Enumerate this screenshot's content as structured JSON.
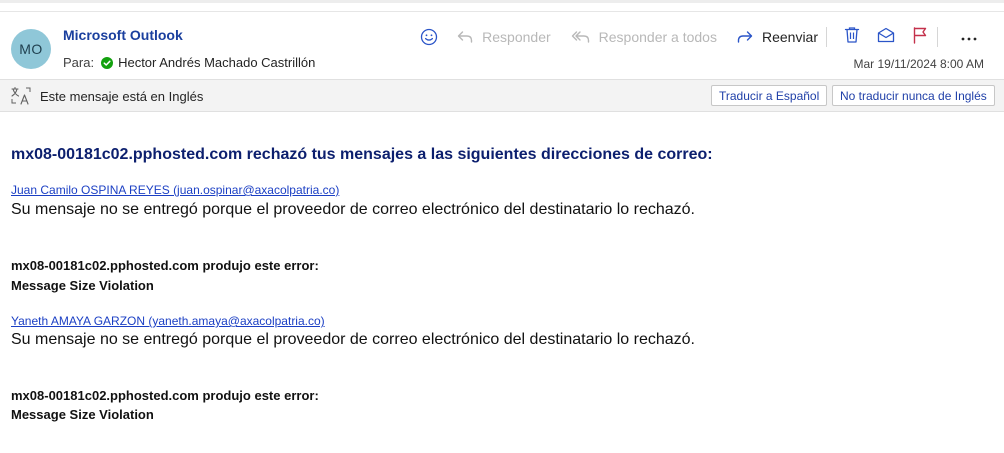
{
  "header": {
    "avatar_initials": "MO",
    "sender": "Microsoft Outlook",
    "to_label": "Para:",
    "recipient": "Hector Andrés Machado Castrillón",
    "date": "Mar 19/11/2024 8:00 AM"
  },
  "toolbar": {
    "emoji_icon": "smiley-icon",
    "reply_label": "Responder",
    "reply_all_label": "Responder a todos",
    "forward_label": "Reenviar",
    "delete_icon": "trash-icon",
    "mark_read_icon": "envelope-open-icon",
    "flag_icon": "flag-icon",
    "more_icon": "more-icon"
  },
  "translation_bar": {
    "icon": "translate-icon",
    "message": "Este mensaje está en Inglés",
    "translate_button": "Traducir a Español",
    "never_translate_button": "No traducir nunca de Inglés"
  },
  "message": {
    "headline": "mx08-00181c02.pphosted.com rechazó tus mensajes a las siguientes direcciones de correo:",
    "failures": [
      {
        "recipient_link": "Juan Camilo OSPINA REYES (juan.ospinar@axacolpatria.co)",
        "reason": "Su mensaje no se entregó porque el proveedor de correo electrónico del destinatario lo rechazó.",
        "error_title": "mx08-00181c02.pphosted.com produjo este error:",
        "error_value": "Message Size Violation"
      },
      {
        "recipient_link": "Yaneth AMAYA GARZON (yaneth.amaya@axacolpatria.co)",
        "reason": "Su mensaje no se entregó porque el proveedor de correo electrónico del destinatario lo rechazó.",
        "error_title": "mx08-00181c02.pphosted.com produjo este error:",
        "error_value": "Message Size Violation"
      }
    ]
  },
  "colors": {
    "accent": "#1a3f9e",
    "headline": "#0c1f6e",
    "link": "#1b3fc4",
    "avatar_bg": "#8fc7d8",
    "verified": "#13a10e",
    "flag": "#c4314b"
  }
}
